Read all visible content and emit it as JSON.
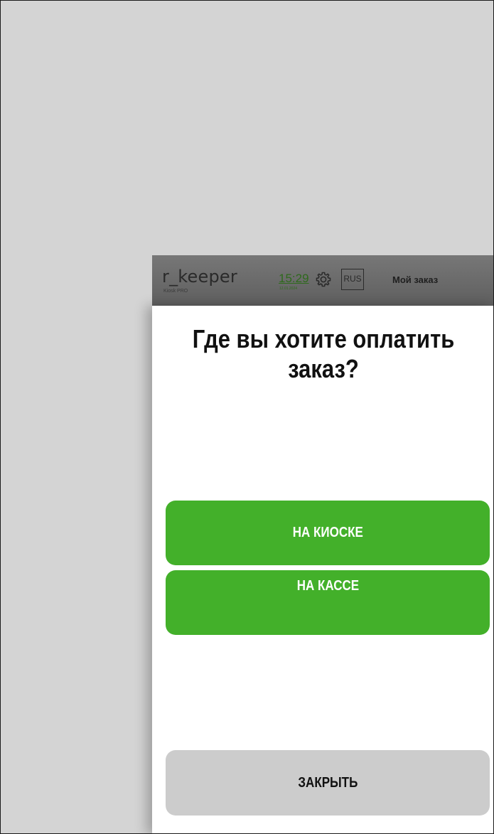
{
  "header": {
    "logo": "r_keeper",
    "logo_sub": "Kiosk PRO",
    "time": "15:29",
    "date": "12.01.2024",
    "language": "RUS",
    "my_order": "Мой заказ"
  },
  "dialog": {
    "title_line1": "Где вы хотите оплатить",
    "title_line2": "заказ?",
    "options": {
      "kiosk": "НА КИОСКЕ",
      "cashier": "НА КАССЕ"
    },
    "close": "ЗАКРЫТЬ"
  },
  "colors": {
    "accent": "#43b02a",
    "close_button": "#cccccc",
    "topbar": "#6a6a6a",
    "clock": "#2e6a1c"
  },
  "icons": {
    "settings": "gear-icon"
  }
}
